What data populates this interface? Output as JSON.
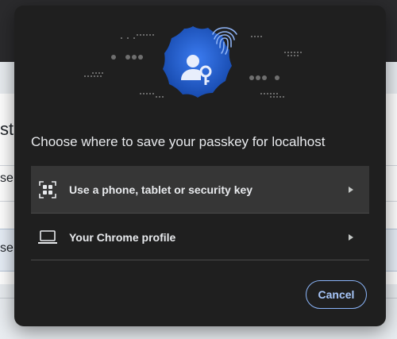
{
  "background": {
    "title_fragment": "st",
    "field1_fragment": "se",
    "field2_fragment": "se"
  },
  "dialog": {
    "title": "Choose where to save your passkey for localhost",
    "options": [
      {
        "label": "Use a phone, tablet or security key",
        "icon": "qr-code-icon"
      },
      {
        "label": "Your Chrome profile",
        "icon": "laptop-icon"
      }
    ],
    "cancel_label": "Cancel"
  },
  "colors": {
    "dialog_bg": "#1f1f1f",
    "accent": "#8ab4f8",
    "badge_blue": "#1a5fd1"
  }
}
